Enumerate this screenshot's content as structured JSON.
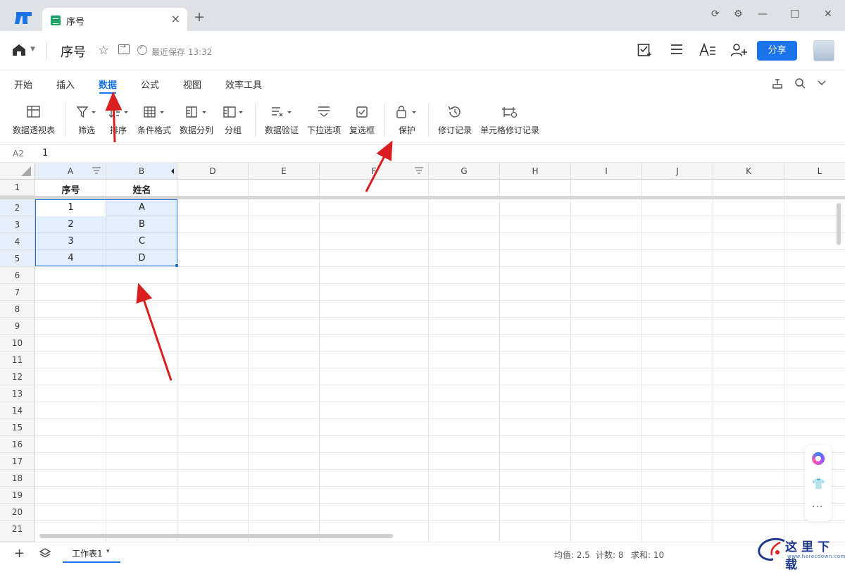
{
  "window": {
    "tab_title": "序号",
    "tab_close": "×",
    "new_tab": "+",
    "controls": {
      "sync": "⟳",
      "settings": "⚙",
      "minimize": "—",
      "maximize": "☐",
      "close": "✕"
    }
  },
  "doc": {
    "title": "序号",
    "save_status": "最近保存 13:32",
    "share_label": "分享"
  },
  "menu": {
    "items": [
      "开始",
      "插入",
      "数据",
      "公式",
      "视图",
      "效率工具"
    ],
    "active": "数据"
  },
  "ribbon": {
    "items": [
      {
        "label": "数据透视表",
        "icon": "pivot-table-icon"
      },
      {
        "label": "筛选",
        "icon": "filter-icon"
      },
      {
        "label": "排序",
        "icon": "sort-icon"
      },
      {
        "label": "条件格式",
        "icon": "conditional-format-icon"
      },
      {
        "label": "数据分列",
        "icon": "split-column-icon"
      },
      {
        "label": "分组",
        "icon": "group-icon"
      },
      {
        "label": "数据验证",
        "icon": "data-validation-icon"
      },
      {
        "label": "下拉选项",
        "icon": "dropdown-options-icon"
      },
      {
        "label": "复选框",
        "icon": "checkbox-icon"
      },
      {
        "label": "保护",
        "icon": "lock-icon"
      },
      {
        "label": "修订记录",
        "icon": "history-icon"
      },
      {
        "label": "单元格修订记录",
        "icon": "cell-history-icon"
      }
    ]
  },
  "formula_bar": {
    "cell_ref": "A2",
    "value": "1"
  },
  "sheet": {
    "columns": [
      "A",
      "B",
      "D",
      "E",
      "F",
      "G",
      "H",
      "I",
      "J",
      "K",
      "L"
    ],
    "rows": [
      "1",
      "2",
      "3",
      "4",
      "5",
      "6",
      "7",
      "8",
      "9",
      "10",
      "11",
      "12",
      "13",
      "14",
      "15",
      "16",
      "17",
      "18",
      "19",
      "20",
      "21"
    ],
    "header_row": [
      "序号",
      "姓名"
    ],
    "data": [
      [
        "1",
        "A"
      ],
      [
        "2",
        "B"
      ],
      [
        "3",
        "C"
      ],
      [
        "4",
        "D"
      ]
    ]
  },
  "bottom": {
    "sheet_tab": "工作表1",
    "sheet_tab_caret": "▾",
    "avg": "均值: 2.5",
    "count": "计数: 8",
    "sum": "求和: 10"
  },
  "watermark": {
    "text": "这里下载",
    "url": "www.herecdown.com"
  },
  "colors": {
    "accent": "#1a73e8",
    "selection": "#e3effc",
    "arrow": "#e02020"
  }
}
